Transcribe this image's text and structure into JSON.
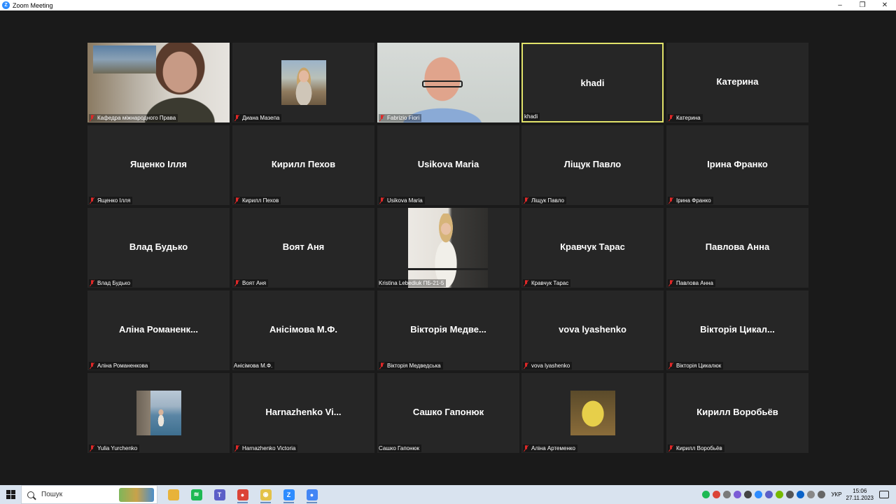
{
  "window": {
    "title": "Zoom Meeting",
    "controls": [
      "–",
      "❐",
      "✕"
    ]
  },
  "tiles": [
    {
      "name": "Кафедра міжнародного Права",
      "center": "",
      "video": "woman-photo"
    },
    {
      "name": "Диана Мазепа",
      "center": "",
      "video": "avatar-girl"
    },
    {
      "name": "Fabrizio Fiori",
      "center": "",
      "video": "man-photo"
    },
    {
      "name": "khadi",
      "center": "khadi",
      "active": true
    },
    {
      "name": "Катерина",
      "center": "Катерина"
    },
    {
      "name": "Ященко Ілля",
      "center": "Ященко Ілля"
    },
    {
      "name": "Кирилл Пехов",
      "center": "Кирилл Пехов"
    },
    {
      "name": "Usikova Maria",
      "center": "Usikova Maria"
    },
    {
      "name": "Ліщук Павло",
      "center": "Ліщук Павло"
    },
    {
      "name": "Ірина Франко",
      "center": "Ірина Франко"
    },
    {
      "name": "Влад Будько",
      "center": "Влад Будько"
    },
    {
      "name": "Воят Аня",
      "center": "Воят Аня"
    },
    {
      "name": "Kristina Lebediuk ПБ-21-5",
      "center": "",
      "video": "mirror-selfie",
      "mic_muted": false
    },
    {
      "name": "Кравчук Тарас",
      "center": "Кравчук Тарас"
    },
    {
      "name": "Павлова Анна",
      "center": "Павлова Анна"
    },
    {
      "name": "Аліна Романенкова",
      "center": "Аліна  Романенк..."
    },
    {
      "name": "Анісімова М.Ф.",
      "center": "Анісімова М.Ф.",
      "mic_muted": false
    },
    {
      "name": "Вікторія Медведська",
      "center": "Вікторія  Медве..."
    },
    {
      "name": "vova lyashenko",
      "center": "vova lyashenko"
    },
    {
      "name": "Вікторія Цикалюк",
      "center": "Вікторія  Цикал..."
    },
    {
      "name": "Yulia Yurchenko",
      "center": "",
      "video": "avatar-sea"
    },
    {
      "name": "Harnazhenko Victoria",
      "center": "Harnazhenko  Vi..."
    },
    {
      "name": "Сашко Гапонюк",
      "center": "Сашко Гапонюк",
      "mic_muted": false
    },
    {
      "name": "Аліна Артеменко",
      "center": "",
      "video": "avatar-meme"
    },
    {
      "name": "Кирилл Воробьёв",
      "center": "Кирилл Воробьёв"
    }
  ],
  "taskbar": {
    "search_placeholder": "Пошук",
    "apps": [
      {
        "icon": "file-explorer-icon",
        "color": "#e8b33a",
        "glyph": ""
      },
      {
        "icon": "spotify-icon",
        "color": "#1db954",
        "glyph": "≋"
      },
      {
        "icon": "teams-icon",
        "color": "#5b5fc7",
        "glyph": "T"
      },
      {
        "icon": "chrome-icon",
        "color": "#db4437",
        "glyph": "●"
      },
      {
        "icon": "app-face-icon",
        "color": "#e3c248",
        "glyph": "◉"
      },
      {
        "icon": "zoom-icon",
        "color": "#2d8cff",
        "glyph": "Z"
      },
      {
        "icon": "chrome-badge-icon",
        "color": "#4285f4",
        "glyph": "●"
      }
    ],
    "language": "УКР",
    "time": "15:06",
    "date": "27.11.2023"
  }
}
